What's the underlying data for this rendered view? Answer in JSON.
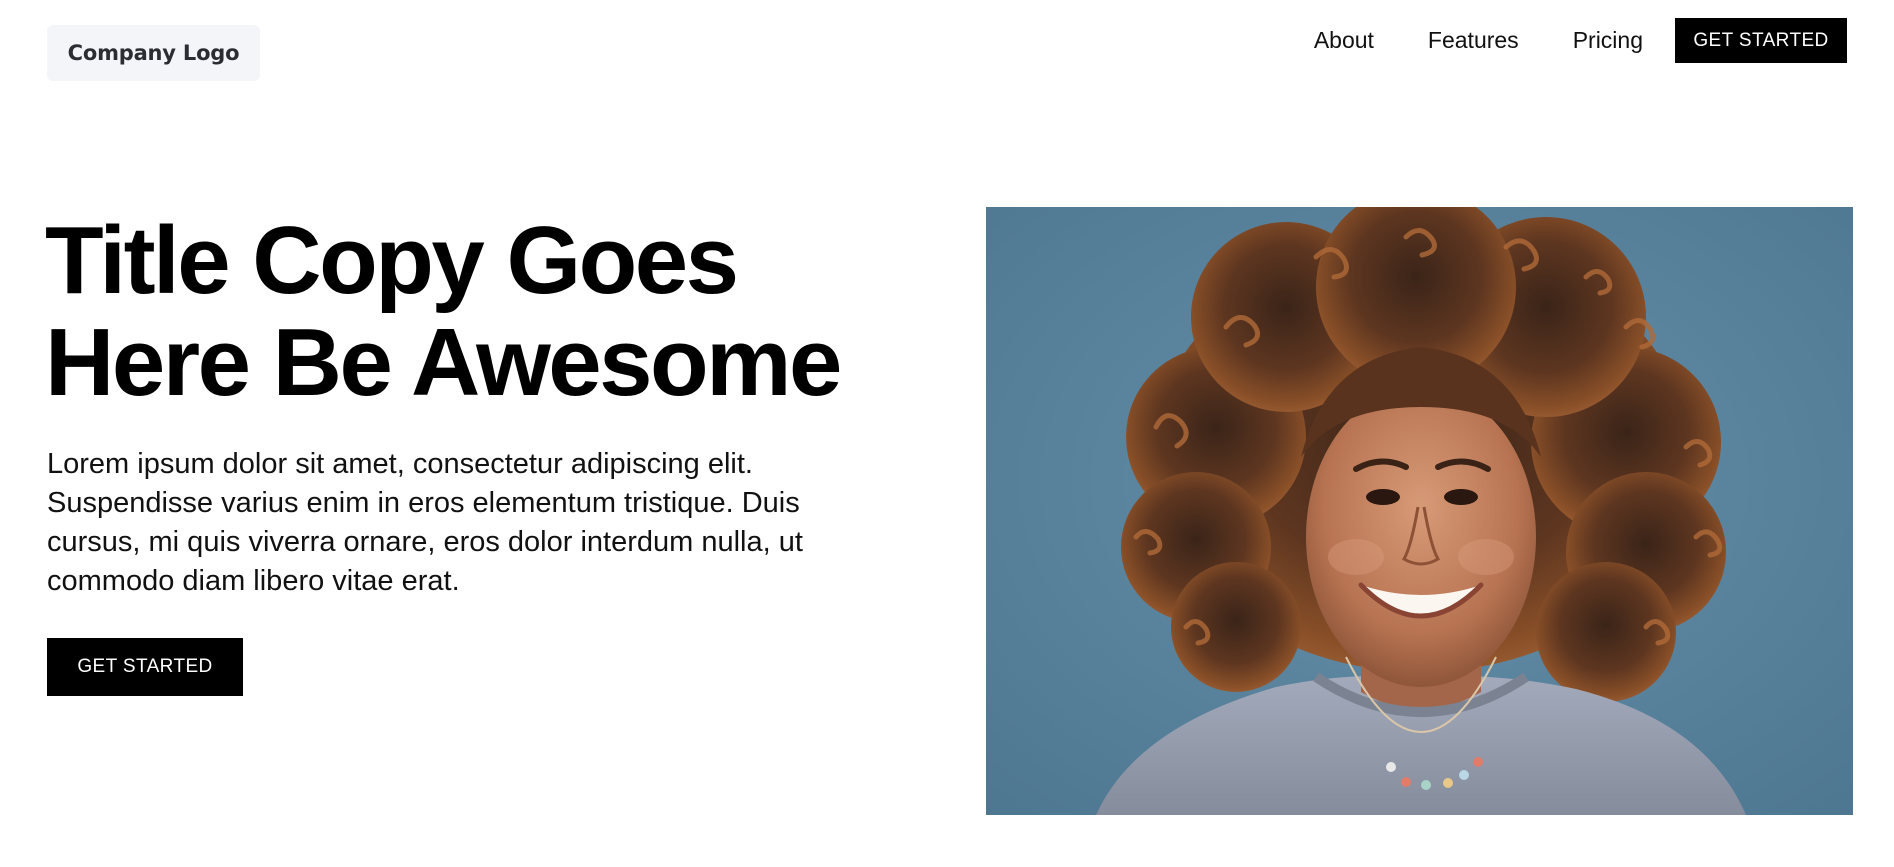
{
  "header": {
    "logo_text": "Company Logo",
    "nav": [
      {
        "label": "About"
      },
      {
        "label": "Features"
      },
      {
        "label": "Pricing"
      }
    ],
    "cta_label": "GET STARTED"
  },
  "hero": {
    "title_lines": [
      "Title Copy Goes",
      "Here Be Awesome"
    ],
    "body_lines": [
      "Lorem ipsum dolor sit amet, consectetur adipiscing elit.",
      "Suspendisse varius enim in eros elementum tristique. Duis",
      "cursus, mi quis viverra ornare, eros dolor interdum nulla, ut",
      "commodo diam libero vitae erat."
    ],
    "cta_label": "GET STARTED"
  },
  "colors": {
    "primary": "#000000",
    "background": "#ffffff",
    "logo_background": "#f4f5f8",
    "photo_backdrop": "#567f9a"
  }
}
